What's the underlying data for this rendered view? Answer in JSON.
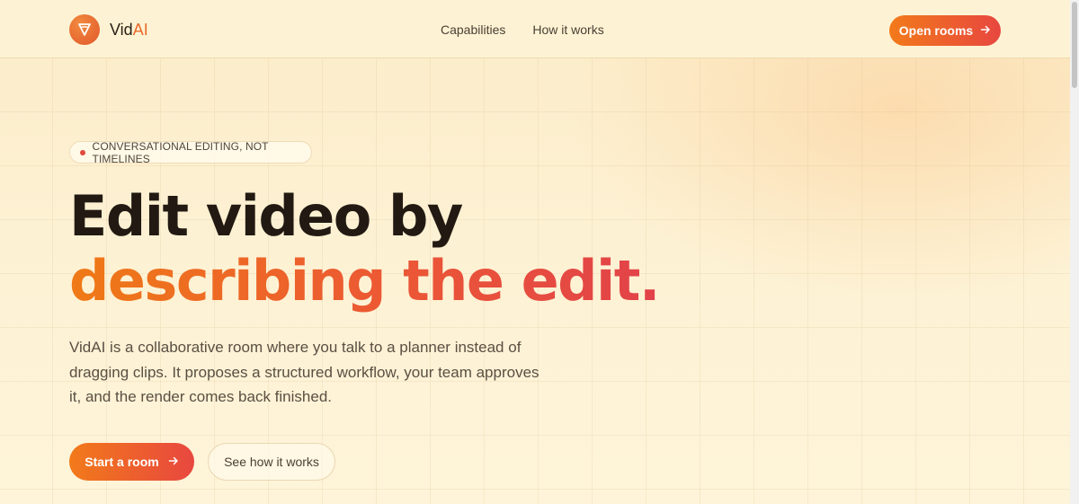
{
  "header": {
    "brand_prefix": "Vid",
    "brand_suffix": "AI",
    "nav": [
      "Capabilities",
      "How it works"
    ],
    "cta_label": "Open rooms",
    "cta_icon": "arrow-right-icon"
  },
  "hero": {
    "badge": "CONVERSATIONAL EDITING, NOT TIMELINES",
    "title_line1": "Edit video by",
    "title_line2": "describing the edit.",
    "lead": "VidAI is a collaborative room where you talk to a planner instead of dragging clips. It proposes a structured workflow, your team approves it, and the render comes back finished.",
    "primary_button": "Start a room",
    "secondary_button": "See how it works"
  },
  "colors": {
    "accent_start": "#f27a1a",
    "accent_end": "#e8473f",
    "background": "#fdf1d3",
    "text": "#221a12"
  }
}
